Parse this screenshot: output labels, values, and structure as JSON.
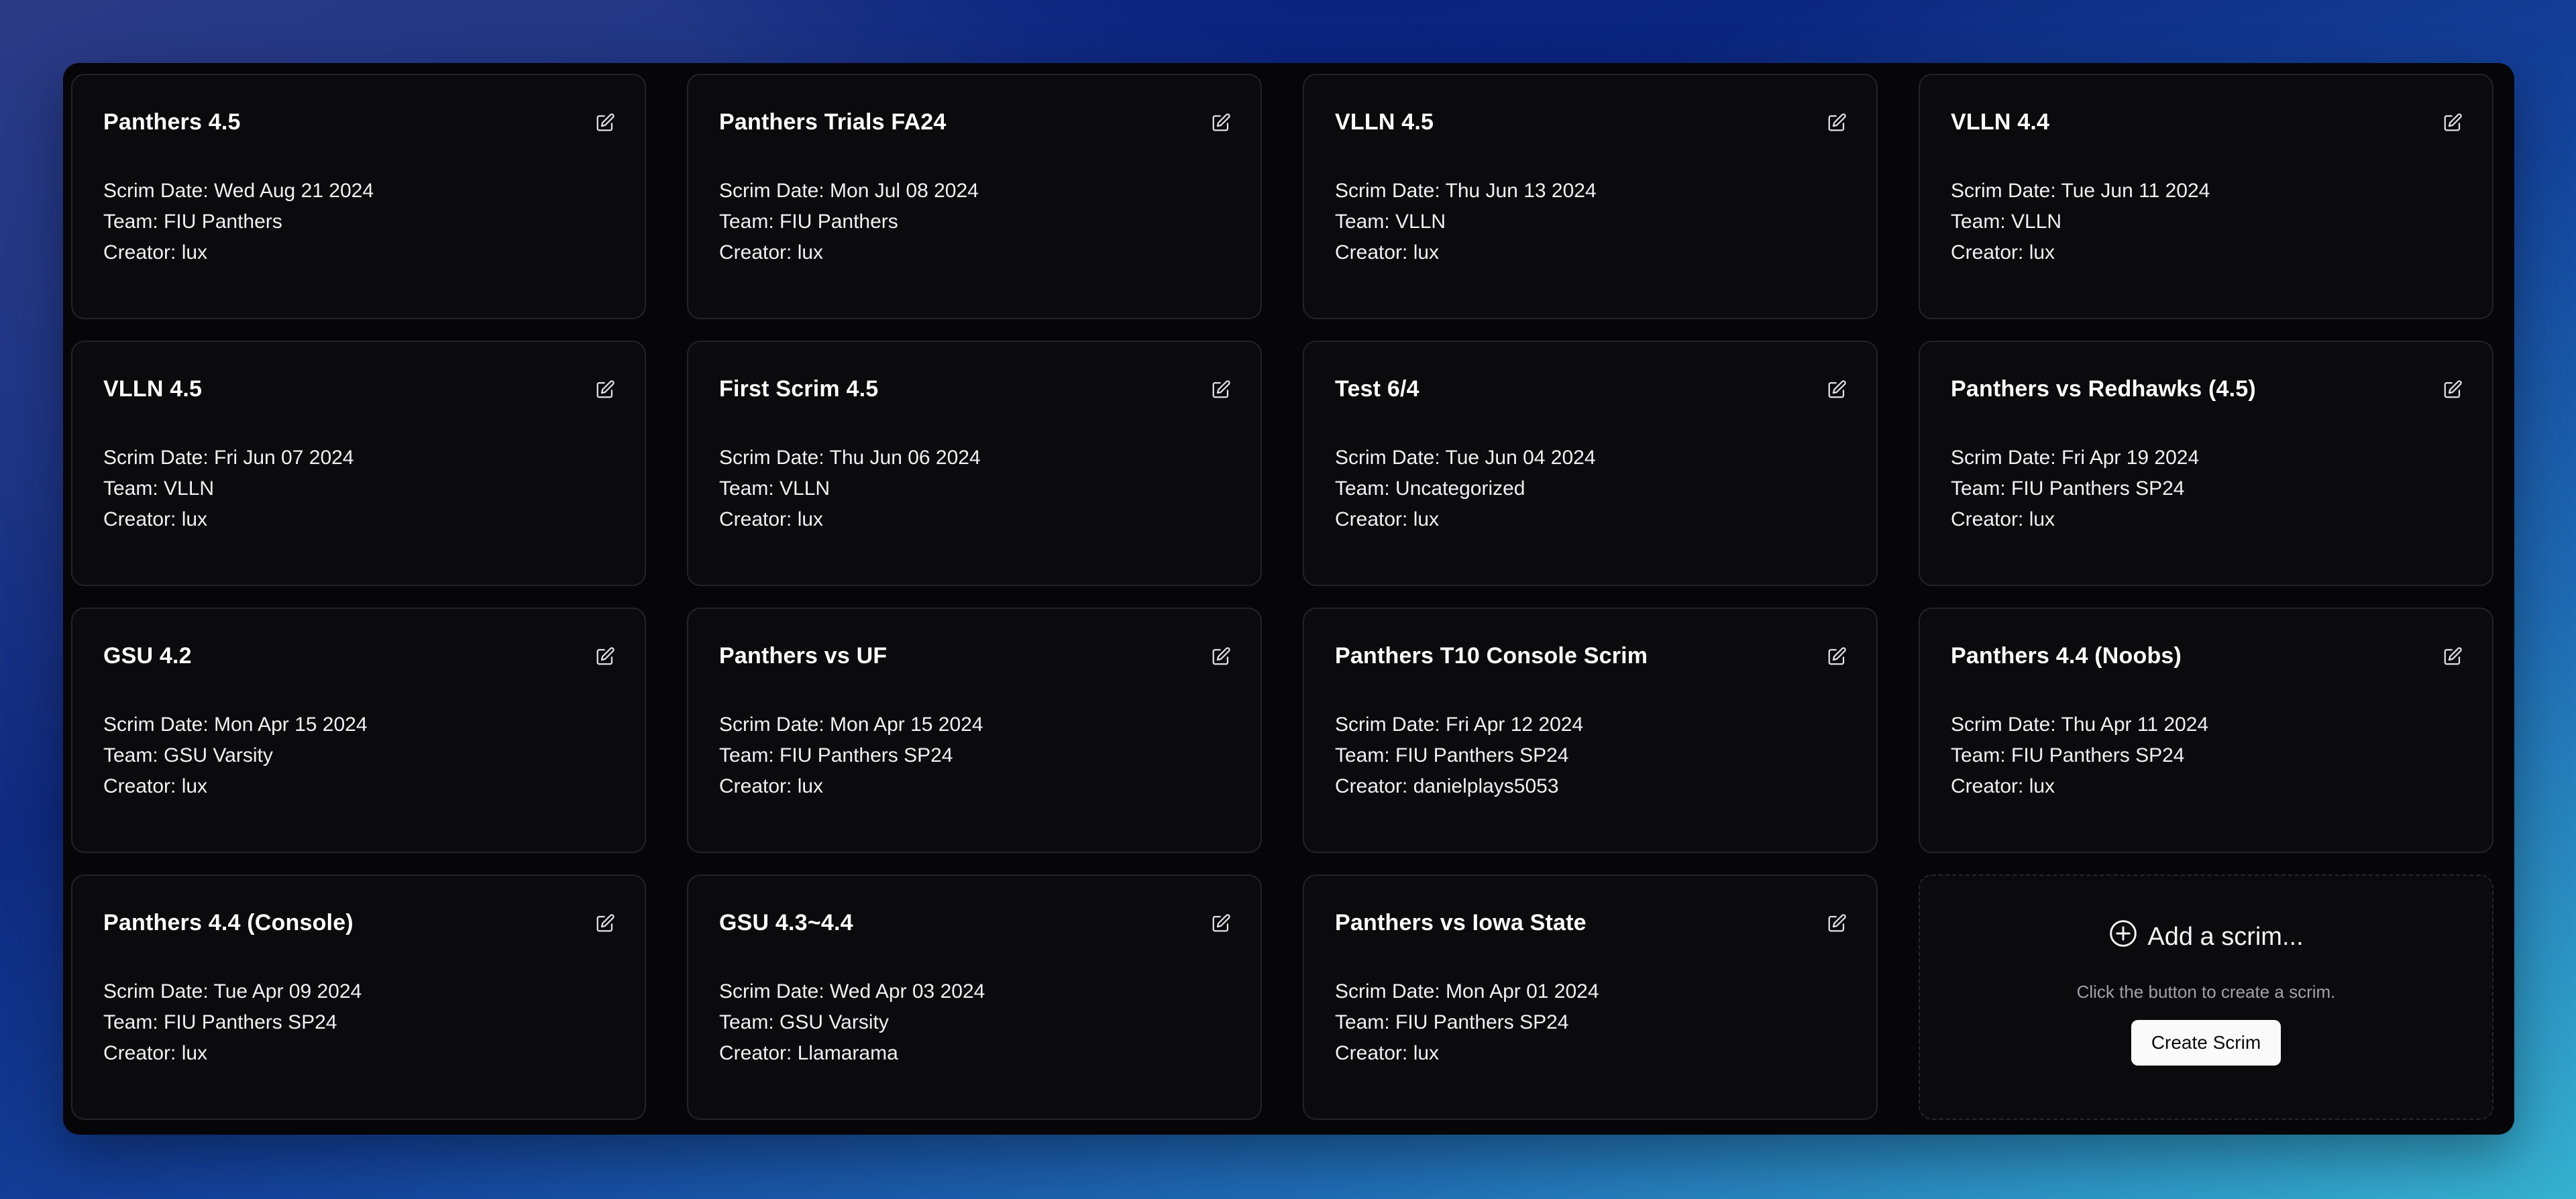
{
  "scrims": [
    {
      "title": "Panthers 4.5",
      "date": "Scrim Date: Wed Aug 21 2024",
      "team": "Team: FIU Panthers",
      "creator": "Creator: lux"
    },
    {
      "title": "Panthers Trials FA24",
      "date": "Scrim Date: Mon Jul 08 2024",
      "team": "Team: FIU Panthers",
      "creator": "Creator: lux"
    },
    {
      "title": "VLLN 4.5",
      "date": "Scrim Date: Thu Jun 13 2024",
      "team": "Team: VLLN",
      "creator": "Creator: lux"
    },
    {
      "title": "VLLN 4.4",
      "date": "Scrim Date: Tue Jun 11 2024",
      "team": "Team: VLLN",
      "creator": "Creator: lux"
    },
    {
      "title": "VLLN 4.5",
      "date": "Scrim Date: Fri Jun 07 2024",
      "team": "Team: VLLN",
      "creator": "Creator: lux"
    },
    {
      "title": "First Scrim 4.5",
      "date": "Scrim Date: Thu Jun 06 2024",
      "team": "Team: VLLN",
      "creator": "Creator: lux"
    },
    {
      "title": "Test 6/4",
      "date": "Scrim Date: Tue Jun 04 2024",
      "team": "Team: Uncategorized",
      "creator": "Creator: lux"
    },
    {
      "title": "Panthers vs Redhawks (4.5)",
      "date": "Scrim Date: Fri Apr 19 2024",
      "team": "Team: FIU Panthers SP24",
      "creator": "Creator: lux"
    },
    {
      "title": "GSU 4.2",
      "date": "Scrim Date: Mon Apr 15 2024",
      "team": "Team: GSU Varsity",
      "creator": "Creator: lux"
    },
    {
      "title": "Panthers vs UF",
      "date": "Scrim Date: Mon Apr 15 2024",
      "team": "Team: FIU Panthers SP24",
      "creator": "Creator: lux"
    },
    {
      "title": "Panthers T10 Console Scrim",
      "date": "Scrim Date: Fri Apr 12 2024",
      "team": "Team: FIU Panthers SP24",
      "creator": "Creator: danielplays5053"
    },
    {
      "title": "Panthers 4.4 (Noobs)",
      "date": "Scrim Date: Thu Apr 11 2024",
      "team": "Team: FIU Panthers SP24",
      "creator": "Creator: lux"
    },
    {
      "title": "Panthers 4.4 (Console)",
      "date": "Scrim Date: Tue Apr 09 2024",
      "team": "Team: FIU Panthers SP24",
      "creator": "Creator: lux"
    },
    {
      "title": "GSU 4.3~4.4",
      "date": "Scrim Date: Wed Apr 03 2024",
      "team": "Team: GSU Varsity",
      "creator": "Creator: Llamarama"
    },
    {
      "title": "Panthers vs Iowa State",
      "date": "Scrim Date: Mon Apr 01 2024",
      "team": "Team: FIU Panthers SP24",
      "creator": "Creator: lux"
    }
  ],
  "add_card": {
    "title": "Add a scrim...",
    "description": "Click the button to create a scrim.",
    "button_label": "Create Scrim",
    "icon": "plus-circle-icon"
  },
  "edit_icon": "edit-icon",
  "colors": {
    "panel_bg": "#060608",
    "card_bg": "#0b0b0e",
    "card_border": "#23242a",
    "text": "#ffffff",
    "muted_text": "#a1a1aa",
    "button_bg": "#fafafa"
  }
}
